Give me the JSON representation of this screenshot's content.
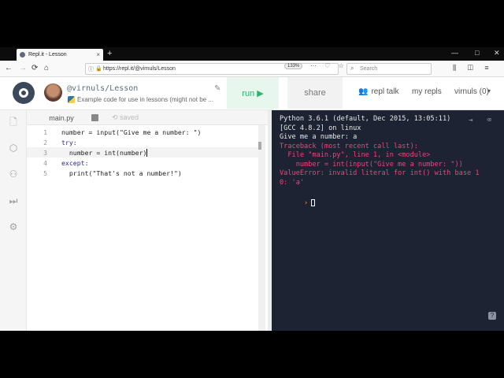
{
  "browser": {
    "tab_title": "Repl.it - Lesson",
    "tab_close": "×",
    "new_tab": "+",
    "url": "https://repl.it/@virnuls/Lesson",
    "zoom": "133%",
    "search_placeholder": "Search",
    "nav_icons": [
      "←",
      "→",
      "⟳",
      "⌂"
    ],
    "win_controls": [
      "—",
      "□",
      "✕"
    ]
  },
  "header": {
    "owner": "@virnuls/Lesson",
    "description": "Example code for use in lessons (might not be ...",
    "run_label": "run ▶",
    "share_label": "share",
    "repl_talk": "repl talk",
    "my_repls": "my repls",
    "user": "virnuls (0)",
    "user_caret": "▾"
  },
  "editor": {
    "file_name": "main.py",
    "saved_label": "saved",
    "lines": [
      {
        "num": "1",
        "text": "number = input(\"Give me a number: \")"
      },
      {
        "num": "2",
        "text": "try:"
      },
      {
        "num": "3",
        "text": "  number = int(number)"
      },
      {
        "num": "4",
        "text": "except:"
      },
      {
        "num": "5",
        "text": "  print(\"That's not a number!\")"
      }
    ]
  },
  "console": {
    "lines": [
      {
        "text": "Python 3.6.1 (default, Dec 2015, 13:05:11)",
        "type": "normal"
      },
      {
        "text": "[GCC 4.8.2] on linux",
        "type": "normal"
      },
      {
        "text": "Give me a number: a",
        "type": "normal"
      },
      {
        "text": "Traceback (most recent call last):",
        "type": "err"
      },
      {
        "text": "  File \"main.py\", line 1, in <module>",
        "type": "err"
      },
      {
        "text": "    number = int(input(\"Give me a number: \"))",
        "type": "err"
      },
      {
        "text": "ValueError: invalid literal for int() with base 1",
        "type": "err"
      },
      {
        "text": "0: 'a'",
        "type": "err"
      }
    ],
    "prompt": "›",
    "help": "?"
  },
  "colors": {
    "console_bg": "#1d2333",
    "error": "#e8477c",
    "run_green": "#2db36b"
  }
}
